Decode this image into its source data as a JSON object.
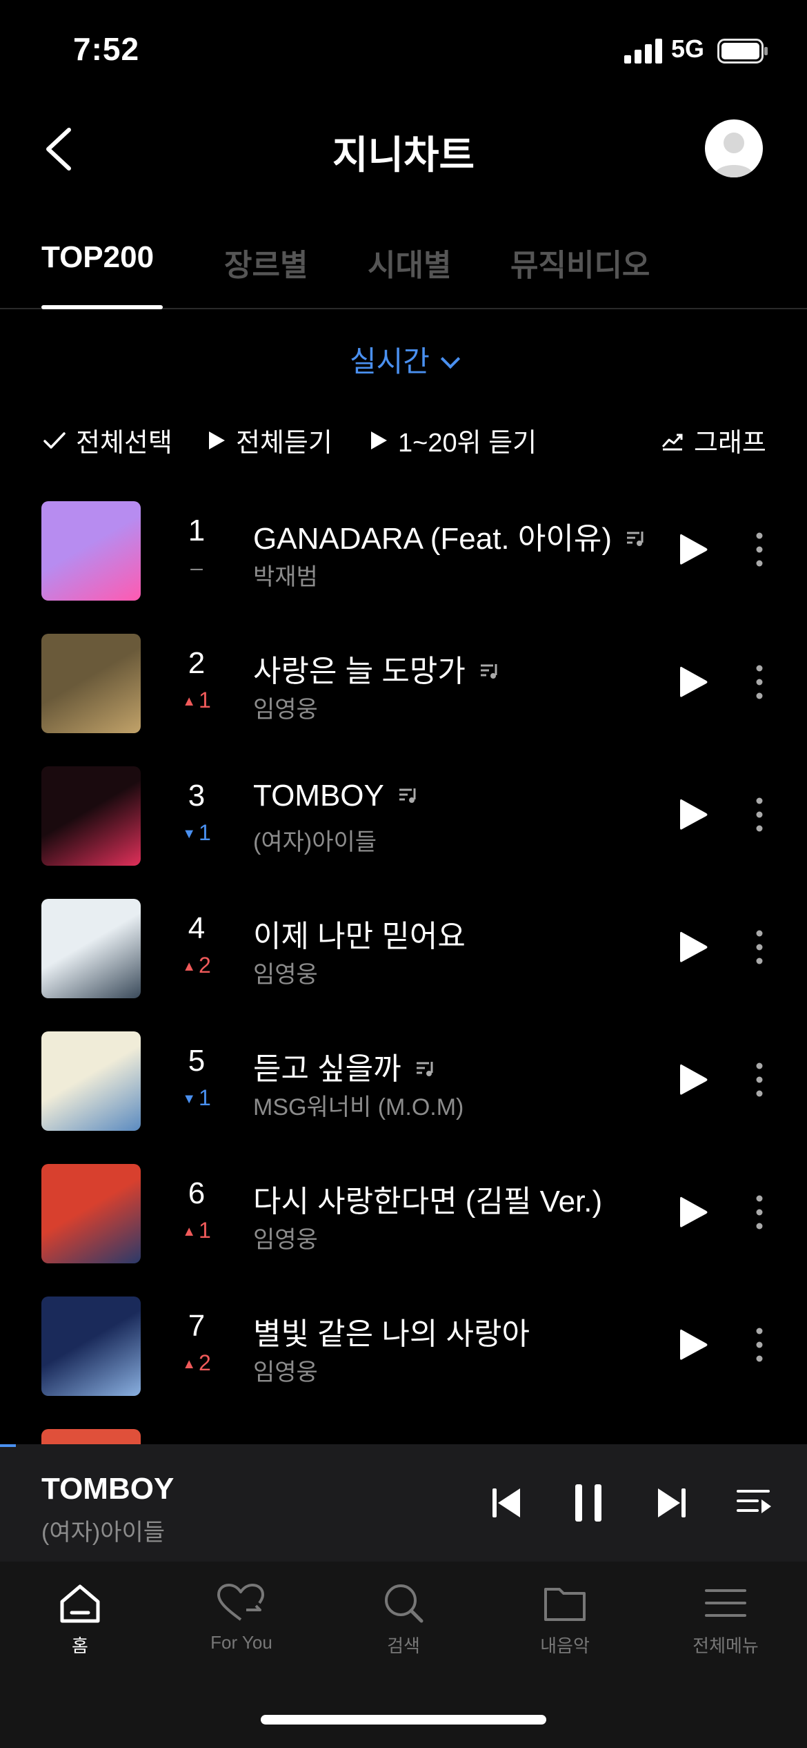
{
  "status_bar": {
    "time": "7:52",
    "network": "5G"
  },
  "header": {
    "title": "지니차트"
  },
  "tabs": [
    {
      "label": "TOP200",
      "active": true
    },
    {
      "label": "장르별",
      "active": false
    },
    {
      "label": "시대별",
      "active": false
    },
    {
      "label": "뮤직비디오",
      "active": false
    }
  ],
  "filter": {
    "selected": "실시간"
  },
  "actions": {
    "select_all": "전체선택",
    "play_all": "전체듣기",
    "play_top20": "1~20위 듣기",
    "graph": "그래프"
  },
  "songs": [
    {
      "rank": "1",
      "change_dir": "same",
      "change": "–",
      "title": "GANADARA (Feat. 아이유)",
      "artist": "박재범",
      "lyrics": true,
      "cover_color": "#b78cf0",
      "cover_accent": "#ff5ab0"
    },
    {
      "rank": "2",
      "change_dir": "up",
      "change": "1",
      "title": "사랑은 늘 도망가",
      "artist": "임영웅",
      "lyrics": true,
      "cover_color": "#6a5a3a",
      "cover_accent": "#c2a36a"
    },
    {
      "rank": "3",
      "change_dir": "down",
      "change": "1",
      "title": "TOMBOY",
      "artist": "(여자)아이들",
      "lyrics": true,
      "cover_color": "#1a0a0e",
      "cover_accent": "#e0305a"
    },
    {
      "rank": "4",
      "change_dir": "up",
      "change": "2",
      "title": "이제 나만 믿어요",
      "artist": "임영웅",
      "lyrics": false,
      "cover_color": "#e8eef2",
      "cover_accent": "#3a4a5a"
    },
    {
      "rank": "5",
      "change_dir": "down",
      "change": "1",
      "title": "듣고 싶을까",
      "artist": "MSG워너비 (M.O.M)",
      "lyrics": true,
      "cover_color": "#f0ecd8",
      "cover_accent": "#5a8ac0"
    },
    {
      "rank": "6",
      "change_dir": "up",
      "change": "1",
      "title": "다시 사랑한다면 (김필 Ver.)",
      "artist": "임영웅",
      "lyrics": false,
      "cover_color": "#d8402e",
      "cover_accent": "#2a3a6a"
    },
    {
      "rank": "7",
      "change_dir": "up",
      "change": "2",
      "title": "별빛 같은 나의 사랑아",
      "artist": "임영웅",
      "lyrics": false,
      "cover_color": "#1a2a5a",
      "cover_accent": "#8ab0e0"
    }
  ],
  "player": {
    "title": "TOMBOY",
    "artist": "(여자)아이들",
    "progress": 0.02
  },
  "bottom_nav": [
    {
      "label": "홈",
      "icon": "home-icon",
      "active": true
    },
    {
      "label": "For You",
      "icon": "heart-icon",
      "active": false
    },
    {
      "label": "검색",
      "icon": "search-icon",
      "active": false
    },
    {
      "label": "내음악",
      "icon": "folder-icon",
      "active": false
    },
    {
      "label": "전체메뉴",
      "icon": "menu-icon",
      "active": false
    }
  ],
  "colors": {
    "accent": "#4a90f0",
    "up": "#f05a5a",
    "down": "#4a90f0",
    "background": "#000000"
  }
}
